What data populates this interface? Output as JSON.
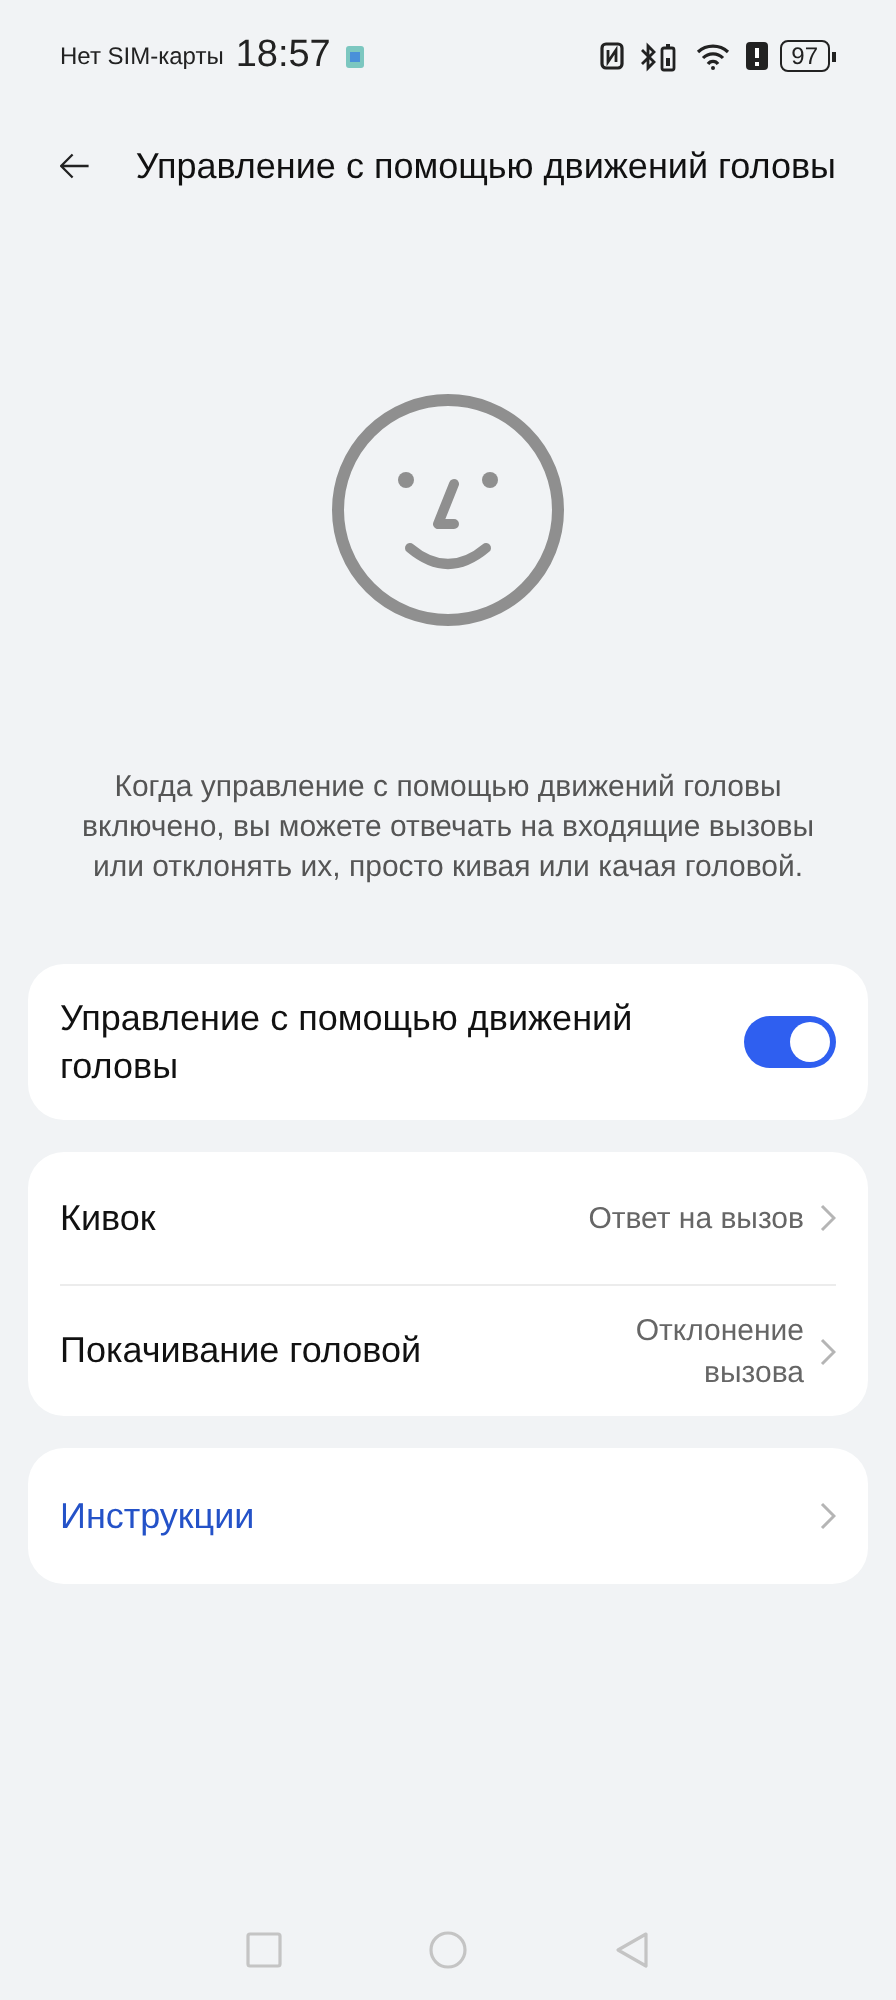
{
  "status_bar": {
    "carrier": "Нет SIM-карты",
    "time": "18:57",
    "battery": "97"
  },
  "header": {
    "title": "Управление с помощью движений головы"
  },
  "description": "Когда управление с помощью движений головы включено, вы можете отвечать на входящие вызовы или отклонять их, просто кивая или качая головой.",
  "main_toggle": {
    "label": "Управление с помощью движений головы",
    "on": true
  },
  "settings": [
    {
      "label": "Кивок",
      "value": "Ответ на вызов"
    },
    {
      "label": "Покачивание головой",
      "value": "Отклонение вызова"
    }
  ],
  "instructions": {
    "label": "Инструкции"
  }
}
